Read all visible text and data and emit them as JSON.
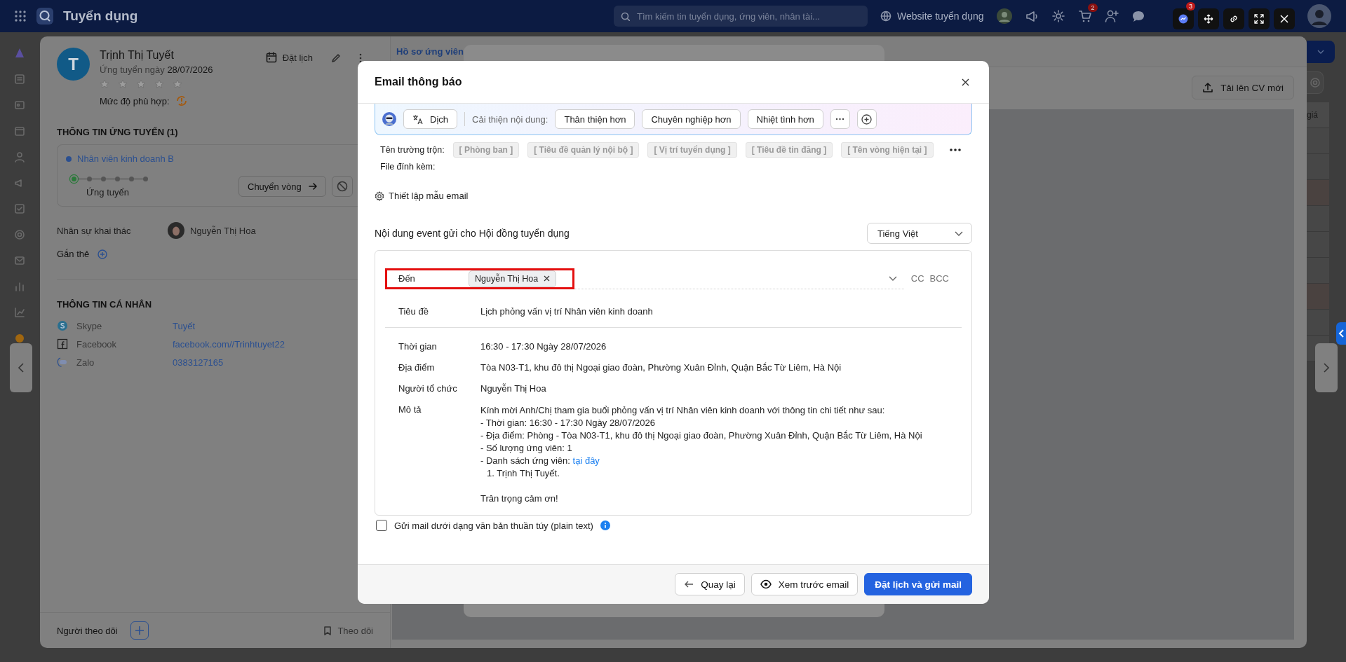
{
  "top_bar": {
    "app_title": "Tuyển dụng",
    "search": {
      "placeholder": "Tìm kiếm tin tuyển dụng, ứng viên, nhân tài..."
    },
    "website_link": "Website tuyển dụng",
    "cart_badge": "2",
    "toolbar_badge": "3"
  },
  "candidate": {
    "initial": "T",
    "name": "Trịnh Thị Tuyết",
    "applied_label": "Ứng tuyển ngày",
    "applied_date": "28/07/2026",
    "stars": 0,
    "match_label": "Mức độ phù hợp:",
    "schedule_button": "Đặt lịch"
  },
  "application": {
    "heading": "THÔNG TIN ỨNG TUYỂN (1)",
    "job": "Nhân viên kinh doanh B",
    "stages": [
      {
        "selected": true
      },
      {
        "selected": false
      },
      {
        "selected": false
      },
      {
        "selected": false
      },
      {
        "selected": false
      },
      {
        "selected": false
      }
    ],
    "stage_label": "Ứng tuyển",
    "move_button": "Chuyển vòng"
  },
  "recruiter": {
    "label": "Nhân sự khai thác",
    "name": "Nguyễn Thị Hoa"
  },
  "tags": {
    "label": "Gắn thẻ"
  },
  "personal": {
    "heading": "THÔNG TIN CÁ NHÂN",
    "rows": [
      {
        "kind": "skype",
        "label": "Skype",
        "value": "Tuyết"
      },
      {
        "kind": "facebook",
        "label": "Facebook",
        "value": "facebook.com//Trinhtuyet22"
      },
      {
        "kind": "zalo",
        "label": "Zalo",
        "value": "0383127165"
      }
    ]
  },
  "panel_footer": {
    "followers_label": "Người theo dõi",
    "follow_button": "Theo dõi"
  },
  "profile_tabs": [
    {
      "label": "Hồ sơ ứng viên",
      "selected": true
    }
  ],
  "upload_button": "Tải lên CV mới",
  "background_table": {
    "column_header": "giá"
  },
  "modal": {
    "title": "Email thông báo",
    "ai_bar": {
      "translate_button": "Dịch",
      "improve_label": "Cải thiện nội dung:",
      "options": [
        "Thân thiện hơn",
        "Chuyên nghiệp hơn",
        "Nhiệt tình hơn"
      ]
    },
    "merge_fields": {
      "label": "Tên trường trộn:",
      "fields": [
        "[ Phòng ban ]",
        "[ Tiêu đề quản lý nội bộ ]",
        "[ Vị trí tuyển dụng ]",
        "[ Tiêu đề tin đăng ]",
        "[ Tên vòng hiện tại ]"
      ]
    },
    "attachments_label": "File đính kèm:",
    "template_link": "Thiết lập mẫu email",
    "event_heading": "Nội dung event gửi cho Hội đồng tuyển dụng",
    "language_select": {
      "value": "Tiếng Việt"
    },
    "email": {
      "to": {
        "label": "Đến",
        "recipients": [
          "Nguyễn Thị Hoa"
        ],
        "highlighted": true
      },
      "cc": "CC",
      "bcc": "BCC",
      "subject": {
        "label": "Tiêu đề",
        "value": "Lịch phỏng vấn vị trí Nhân viên kinh doanh"
      },
      "details": [
        {
          "label": "Thời gian",
          "value": "16:30 - 17:30 Ngày 28/07/2026"
        },
        {
          "label": "Địa điểm",
          "value": "Tòa N03-T1, khu đô thị Ngoại giao đoàn, Phường Xuân Đỉnh, Quận Bắc Từ Liêm, Hà Nội"
        },
        {
          "label": "Người tổ chức",
          "value": "Nguyễn Thị Hoa"
        }
      ],
      "description": {
        "label": "Mô tả",
        "lines": [
          {
            "kind": "text",
            "text": "Kính mời Anh/Chị tham gia buổi phỏng vấn vị trí Nhân viên kinh doanh với thông tin chi tiết như sau:"
          },
          {
            "kind": "text",
            "text": "- Thời gian: 16:30 - 17:30 Ngày 28/07/2026"
          },
          {
            "kind": "text",
            "text": "- Địa điểm: Phòng - Tòa N03-T1, khu đô thị Ngoại giao đoàn, Phường Xuân Đỉnh, Quận Bắc Từ Liêm, Hà Nội"
          },
          {
            "kind": "text",
            "text": "- Số lượng ứng viên: 1"
          },
          {
            "kind": "link",
            "text": "- Danh sách ứng viên:",
            "link": "tại đây"
          },
          {
            "kind": "indent",
            "text": "1. Trịnh Thị Tuyết."
          }
        ],
        "closing": "Trân trọng cảm ơn!"
      }
    },
    "plain_text": {
      "label": "Gửi mail dưới dạng văn bản thuần túy (plain text)",
      "checked": false
    },
    "buttons": {
      "back": "Quay lại",
      "preview": "Xem trước email",
      "submit": "Đặt lịch và gửi mail"
    }
  }
}
